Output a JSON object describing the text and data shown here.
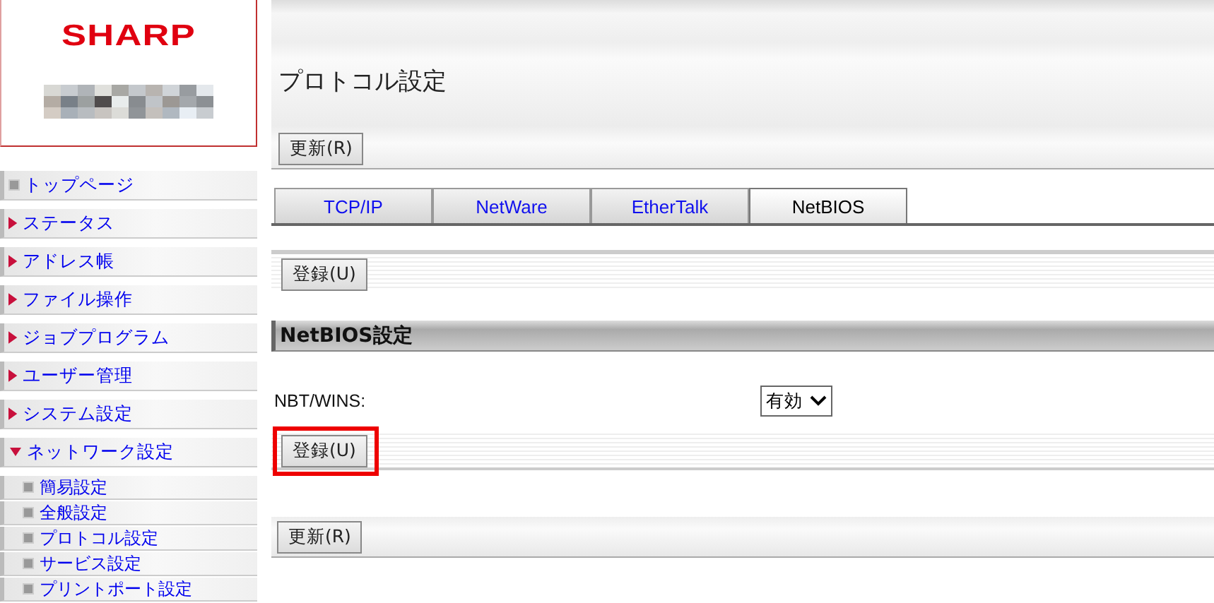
{
  "logo": {
    "text": "SHARP"
  },
  "sidebar": {
    "items": [
      {
        "label": "トップページ",
        "kind": "page"
      },
      {
        "label": "ステータス",
        "kind": "section",
        "expanded": false
      },
      {
        "label": "アドレス帳",
        "kind": "section",
        "expanded": false
      },
      {
        "label": "ファイル操作",
        "kind": "section",
        "expanded": false
      },
      {
        "label": "ジョブプログラム",
        "kind": "section",
        "expanded": false
      },
      {
        "label": "ユーザー管理",
        "kind": "section",
        "expanded": false
      },
      {
        "label": "システム設定",
        "kind": "section",
        "expanded": false
      },
      {
        "label": "ネットワーク設定",
        "kind": "section",
        "expanded": true,
        "children": [
          {
            "label": "簡易設定"
          },
          {
            "label": "全般設定"
          },
          {
            "label": "プロトコル設定"
          },
          {
            "label": "サービス設定"
          },
          {
            "label": "プリントポート設定"
          }
        ]
      }
    ]
  },
  "page_title": "プロトコル設定",
  "top_button": "更新(R)",
  "tabs": [
    {
      "label": "TCP/IP",
      "selected": false
    },
    {
      "label": "NetWare",
      "selected": false
    },
    {
      "label": "EtherTalk",
      "selected": false
    },
    {
      "label": "NetBIOS",
      "selected": true
    }
  ],
  "register_top": {
    "label": "登録(U)"
  },
  "section_title": "NetBIOS設定",
  "fields": [
    {
      "label": "NBT/WINS:",
      "value": "有効"
    }
  ],
  "register_bottom": {
    "label": "登録(U)",
    "highlighted": true
  },
  "bottom_button": "更新(R)"
}
